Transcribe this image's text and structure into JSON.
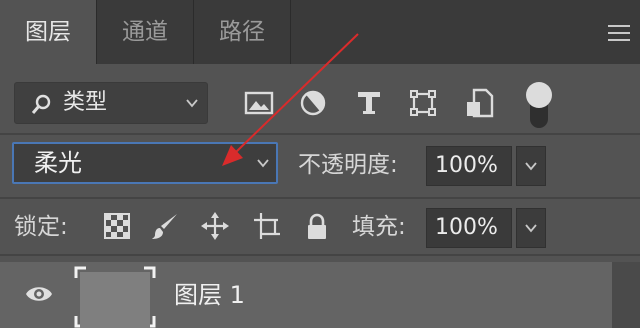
{
  "tabs": [
    {
      "label": "图层",
      "active": true
    },
    {
      "label": "通道",
      "active": false
    },
    {
      "label": "路径",
      "active": false
    }
  ],
  "filter": {
    "icon": "search-icon",
    "label": "类型"
  },
  "filter_icons": [
    "image-filter-icon",
    "adjustment-filter-icon",
    "text-filter-icon",
    "shape-filter-icon",
    "smart-object-filter-icon"
  ],
  "filter_toggle": {
    "on": true
  },
  "blend": {
    "label": "柔光"
  },
  "opacity": {
    "label": "不透明度:",
    "value": "100%"
  },
  "lock": {
    "label": "锁定:",
    "icons": [
      "lock-transparent-pixels-icon",
      "lock-image-pixels-icon",
      "lock-position-icon",
      "lock-artboard-icon",
      "lock-all-icon"
    ]
  },
  "fill": {
    "label": "填充:",
    "value": "100%"
  },
  "layer": {
    "name": "图层 1",
    "visible": true
  },
  "colors": {
    "accent_border": "#4a77b5",
    "annotation_arrow": "#d92b2b",
    "panel_bg": "#535353",
    "tabbar_bg": "#3a3a3a"
  }
}
